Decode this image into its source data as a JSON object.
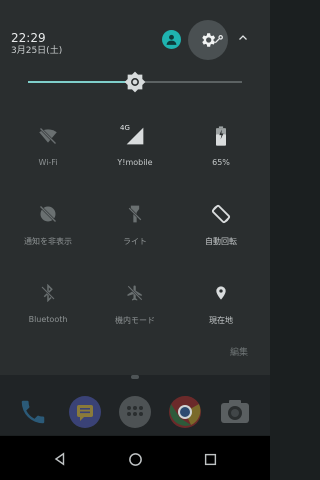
{
  "status": {
    "time": "22:29",
    "date": "3月25日(土)"
  },
  "brightness": {
    "level": 0.5
  },
  "tiles": [
    {
      "label": "Wi-Fi",
      "icon": "wifi-off-icon",
      "active": false
    },
    {
      "label": "Y!mobile",
      "icon": "cell-signal-icon",
      "badge": "4G",
      "active": true
    },
    {
      "label": "65%",
      "icon": "battery-icon",
      "active": true
    },
    {
      "label": "通知を非表示",
      "icon": "do-not-disturb-icon",
      "active": false
    },
    {
      "label": "ライト",
      "icon": "flashlight-icon",
      "active": false
    },
    {
      "label": "自動回転",
      "icon": "auto-rotate-icon",
      "active": true
    },
    {
      "label": "Bluetooth",
      "icon": "bluetooth-off-icon",
      "active": false
    },
    {
      "label": "機内モード",
      "icon": "airplane-icon",
      "active": false
    },
    {
      "label": "現在地",
      "icon": "location-icon",
      "active": true
    }
  ],
  "edit_label": "編集",
  "colors": {
    "accent": "#1fb3b0",
    "shade": "#2a2e2f"
  }
}
